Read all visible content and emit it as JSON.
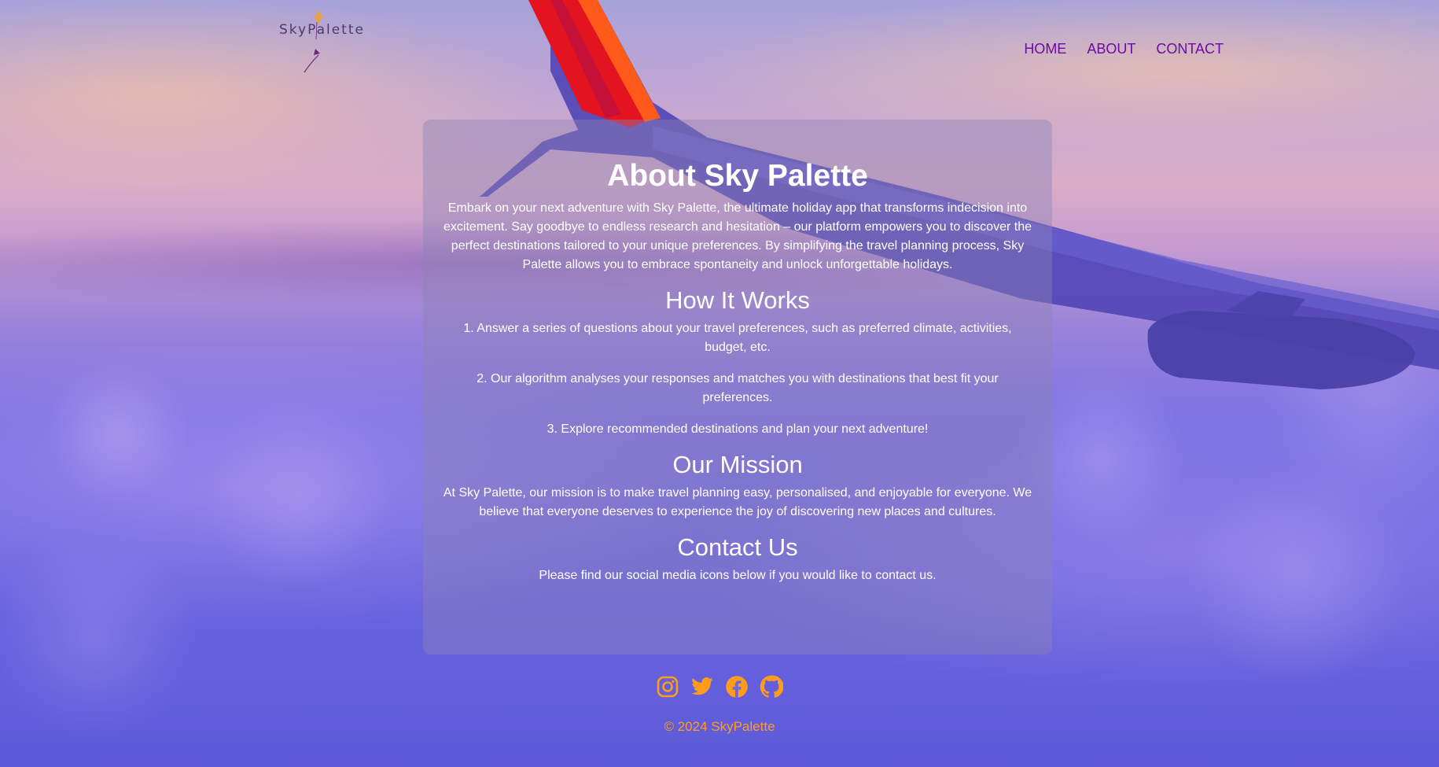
{
  "brand": {
    "logo_text": "SkyPalette"
  },
  "nav": {
    "items": [
      {
        "label": "HOME"
      },
      {
        "label": "ABOUT"
      },
      {
        "label": "CONTACT"
      }
    ],
    "color": "#6a0da6"
  },
  "about": {
    "title": "About Sky Palette",
    "intro": "Embark on your next adventure with Sky Palette, the ultimate holiday app that transforms indecision into excitement. Say goodbye to endless research and hesitation – our platform empowers you to discover the perfect destinations tailored to your unique preferences. By simplifying the travel planning process, Sky Palette allows you to embrace spontaneity and unlock unforgettable holidays."
  },
  "how_it_works": {
    "title": "How It Works",
    "steps": [
      "1. Answer a series of questions about your travel preferences, such as preferred climate, activities, budget, etc.",
      "2. Our algorithm analyses your responses and matches you with destinations that best fit your preferences.",
      "3. Explore recommended destinations and plan your next adventure!"
    ]
  },
  "mission": {
    "title": "Our Mission",
    "text": "At Sky Palette, our mission is to make travel planning easy, personalised, and enjoyable for everyone. We believe that everyone deserves to experience the joy of discovering new places and cultures."
  },
  "contact": {
    "title": "Contact Us",
    "text": "Please find our social media icons below if you would like to contact us."
  },
  "footer": {
    "socials": [
      "instagram-icon",
      "twitter-icon",
      "facebook-icon",
      "github-icon"
    ],
    "copyright": "© 2024 SkyPalette",
    "accent_color": "#ff9d1a"
  }
}
